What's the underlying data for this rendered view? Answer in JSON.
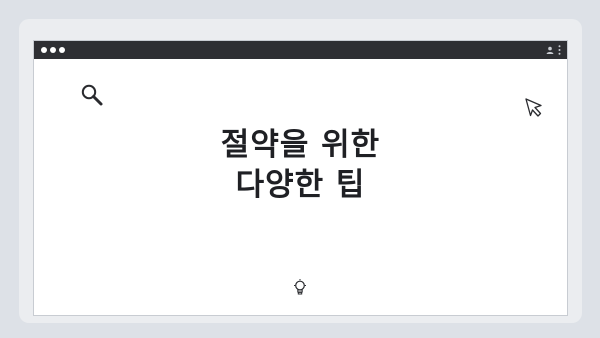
{
  "slide": {
    "title_line1": "절약을 위한",
    "title_line2": "다양한 팁"
  },
  "icons": {
    "search": "search-icon",
    "cursor": "cursor-icon",
    "lightbulb": "lightbulb-icon",
    "user": "user-icon",
    "menu": "kebab-menu-icon"
  },
  "colors": {
    "background": "#dde1e7",
    "frame": "#ebedf0",
    "titlebar": "#2e2f33",
    "window": "#ffffff",
    "text": "#1f2024"
  }
}
